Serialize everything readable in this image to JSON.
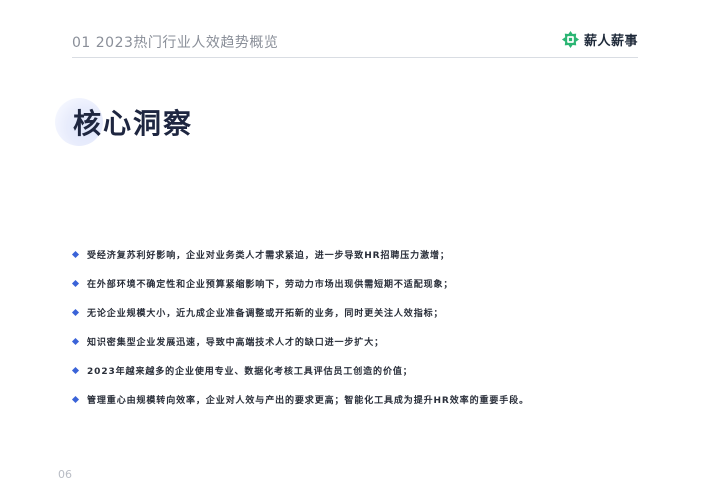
{
  "header": {
    "title": "01  2023热门行业人效趋势概览",
    "logo_text": "薪人薪事",
    "logo_icon": "brand-logo-icon",
    "accent_color": "#2bb573"
  },
  "section": {
    "title": "核心洞察"
  },
  "bullets": [
    "受经济复苏利好影响，企业对业务类人才需求紧迫，进一步导致HR招聘压力激增；",
    "在外部环境不确定性和企业预算紧缩影响下，劳动力市场出现供需短期不适配现象；",
    "无论企业规模大小，近九成企业准备调整或开拓新的业务，同时更关注人效指标；",
    "知识密集型企业发展迅速，导致中高端技术人才的缺口进一步扩大；",
    "2023年越来越多的企业使用专业、数据化考核工具评估员工创造的价值；",
    "管理重心由规模转向效率，企业对人效与产出的要求更高；智能化工具成为提升HR效率的重要手段。"
  ],
  "bullet_color": "#3a63d8",
  "page_number": "06"
}
